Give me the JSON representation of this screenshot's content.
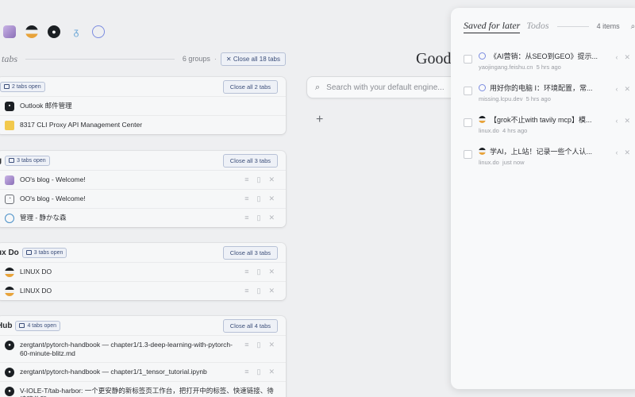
{
  "favorites": [
    {
      "icon": "avatar-photo-icon",
      "color": "#b8a0d8"
    },
    {
      "icon": "linux-do-icon",
      "color": "#e8a33a"
    },
    {
      "icon": "github-icon",
      "color": "#1b1f23"
    },
    {
      "icon": "seahorse-icon",
      "color": "#6aa6d6"
    },
    {
      "icon": "globe-icon",
      "color": "#7b8ce0"
    }
  ],
  "tabs_header": {
    "title": "tabs",
    "groups_count": "6 groups",
    "close_all_label": "Close all 18 tabs"
  },
  "groups": [
    {
      "name": "",
      "pill": "2 tabs open",
      "close_label": "Close all 2 tabs",
      "tabs": [
        {
          "title": "Outlook 邮件管理",
          "icon": "outlook-icon"
        },
        {
          "title": "8317 CLI Proxy API Management Center",
          "icon": "proxy-icon"
        }
      ]
    },
    {
      "name": "g",
      "pill": "3 tabs open",
      "close_label": "Close all 3 tabs",
      "tabs": [
        {
          "title": "OO's blog - Welcome!",
          "icon": "avatar-photo-icon"
        },
        {
          "title": "OO's blog - Welcome!",
          "icon": "robot-icon"
        },
        {
          "title": "管理 - 静かな森",
          "icon": "globe-icon"
        }
      ]
    },
    {
      "name": "ux Do",
      "pill": "3 tabs open",
      "close_label": "Close all 3 tabs",
      "tabs": [
        {
          "title": "LINUX DO",
          "icon": "linux-do-icon"
        },
        {
          "title": "LINUX DO",
          "icon": "linux-do-icon"
        }
      ]
    },
    {
      "name": "Hub",
      "pill": "4 tabs open",
      "close_label": "Close all 4 tabs",
      "tabs": [
        {
          "title": "zergtant/pytorch-handbook — chapter1/1.3-deep-learning-with-pytorch-60-minute-blitz.md",
          "icon": "github-icon"
        },
        {
          "title": "zergtant/pytorch-handbook — chapter1/1_tensor_tutorial.ipynb",
          "icon": "github-icon"
        },
        {
          "title": "V-IOLE-T/tab-harbor: 一个更安静的新标签页工作台，把打开中的标签、快速链接、待读稿件和...",
          "icon": "github-icon"
        }
      ]
    }
  ],
  "center": {
    "greeting": "Good",
    "search_placeholder": "Search with your default engine..."
  },
  "saved_panel": {
    "tab_saved": "Saved for later",
    "tab_todos": "Todos",
    "items_count": "4 items",
    "items": [
      {
        "title": "《AI营销：从SEO到GEO》提示...",
        "source": "yaojingang.feishu.cn",
        "time": "5 hrs ago",
        "icon": "globe-icon"
      },
      {
        "title": "用好你的电脑 I：环境配置，常...",
        "source": "missing.lcpu.dev",
        "time": "5 hrs ago",
        "icon": "globe-icon"
      },
      {
        "title": "【grok不止with tavily mcp】模...",
        "source": "linux.do",
        "time": "4 hrs ago",
        "icon": "linux-do-icon"
      },
      {
        "title": "学AI，上L站！记录一些个人认...",
        "source": "linux.do",
        "time": "just now",
        "icon": "linux-do-icon"
      }
    ]
  }
}
